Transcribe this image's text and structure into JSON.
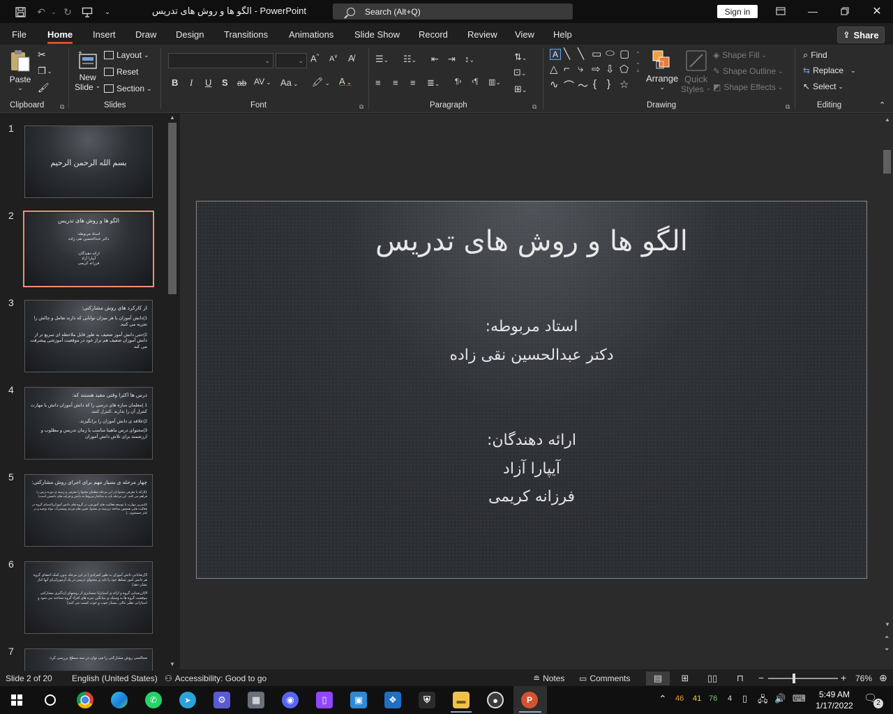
{
  "app": {
    "doc_title": "الگو ها و روش های تدریس  -  PowerPoint",
    "search_placeholder": "Search (Alt+Q)",
    "signin": "Sign in",
    "share": "Share"
  },
  "tabs": [
    "File",
    "Home",
    "Insert",
    "Draw",
    "Design",
    "Transitions",
    "Animations",
    "Slide Show",
    "Record",
    "Review",
    "View",
    "Help"
  ],
  "ribbon": {
    "clipboard": {
      "label": "Clipboard",
      "paste": "Paste"
    },
    "slides": {
      "label": "Slides",
      "new_slide_1": "New",
      "new_slide_2": "Slide",
      "layout": "Layout",
      "reset": "Reset",
      "section": "Section"
    },
    "font": {
      "label": "Font",
      "bold": "B",
      "italic": "I",
      "underline": "U",
      "shadow": "S",
      "strike": "ab",
      "spacing": "AV",
      "case": "Aa"
    },
    "paragraph": {
      "label": "Paragraph"
    },
    "drawing": {
      "label": "Drawing",
      "arrange": "Arrange",
      "quick_styles_1": "Quick",
      "quick_styles_2": "Styles",
      "shape_fill": "Shape Fill",
      "shape_outline": "Shape Outline",
      "shape_effects": "Shape Effects"
    },
    "editing": {
      "label": "Editing",
      "find": "Find",
      "replace": "Replace",
      "select": "Select"
    }
  },
  "thumbnails": [
    {
      "num": "1",
      "title": "بسم الله الرحمن الرحیم"
    },
    {
      "num": "2",
      "title": "الگو ها و روش های تدریس",
      "l1": "استاد مربوطه:",
      "l2": "دکتر عبدالحسین نقی زاده",
      "l3": "ارائه دهندگان:",
      "l4": "آیپارا آزاد",
      "l5": "فرزانه کریمی"
    },
    {
      "num": "3",
      "title": "از کارکرد های روش مشارکتی:",
      "p1": "1)دانش آموزان با هر میزان توانایی که دارند تعامل و چالش را تجربه می کنند.",
      "p2": "2)حتی دانش آموز ضعیف به طور قابل ملاحظه ای سریع تر از دانش آموزان ضعیف هم تراز خود در موقعیت آموزشی پیشرفت می کند"
    },
    {
      "num": "4",
      "title": "درس ها اکثرا وقتی مفید هستند که:",
      "p1": "1 )معلمان سازه های درسی را که دانش آموزان دانش یا مهارت کنترل آن را ندارند ،کنترل کنند.",
      "p2": "2)علاقه ی دانش آموزان را برانگیزند.",
      "p3": "3)محتوای درس ماهیتا مناسب با زمان تدریس و مطلوب و ارزشمند برای تلاش دانش آموزان"
    },
    {
      "num": "5",
      "title": "چهار مرحله ی بسیار مهم برای اجرای روش مشارکتی:",
      "p1": "1)ارائه یا معرفی محتوا (در این مرحله معلمان محتوا را معرفی و زمینه ی دوره درس را فراهم می کنند. این مرحله باید به ساختار مربوط به دانش و فرایند های دانستن است)",
      "p2": "2)تمرین مهارت یا توسعه فعالیت های آموزشی در گروه های دانش آموزان(اعضای گروه در فعالیت هایی همچون مباحثه درزمینه ی محتوا، تعیین های فردی ومشترک، مواد توجیه و در کنار جستجوی...)"
    },
    {
      "num": "6",
      "p1": "3)رضایابی دانش آموزان به طور انفرادی ( در این مرحله بدون کمک اعضای گروه هر دانش آموز تسلط خود را باید بر محتوای درسی در یک آزمون(برای آنها کنار نشان دهد)",
      "p2": "4)ارزشیابی گروه و ارائه ی امتیاز(با تمسایزی از روشهای ازدگیری مشارکتی موفقیت گروه ها به وسیله ی میانگین نمره های افراد گروه شناخته می شود و امتیازاتی نظیر عالی ،بسیار خوب و خوب کسب می کنند)"
    },
    {
      "num": "7",
      "title": "مجالسی روش مشارکتی را می توان در سه سطح بررسی کرد:"
    }
  ],
  "slide": {
    "title": "الگو ها و روش های تدریس",
    "teacher_label": "استاد مربوطه:",
    "teacher": "دکتر عبدالحسین نقی زاده",
    "presenters_label": "ارائه دهندگان:",
    "presenter_1": "آیپارا آزاد",
    "presenter_2": "فرزانه کریمی"
  },
  "status": {
    "slide_info": "Slide 2 of 20",
    "language": "English (United States)",
    "accessibility": "Accessibility: Good to go",
    "notes": "Notes",
    "comments": "Comments",
    "zoom_minus": "−",
    "zoom_plus": "+",
    "zoom": "76%",
    "zoom_level_percent": 76
  },
  "taskbar": {
    "tray_1": "46",
    "tray_2": "41",
    "tray_3": "76",
    "tray_4": "4",
    "time": "5:49 AM",
    "date": "1/17/2022",
    "notifications": "2"
  },
  "colors": {
    "accent": "#d35230",
    "selected_thumb": "#f08e76",
    "tray_1": "#e8a23c",
    "tray_2": "#e8d84a",
    "tray_3": "#7bc87b"
  }
}
